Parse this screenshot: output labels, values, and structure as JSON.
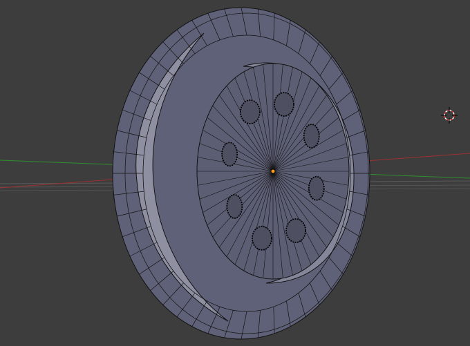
{
  "viewport": {
    "background_color": "#3d3d3d",
    "grid_line_color": "#5a5a5a",
    "axis_x_color": "#a03030",
    "axis_y_color": "#2f8f2f",
    "view_type": "3d-viewport-edit-mode"
  },
  "mesh": {
    "object": "disc-with-holes",
    "face_color": "#5f6178",
    "face_dark_color": "#52546a",
    "face_light_color": "#8e90a2",
    "edge_color": "#111111",
    "selected_vertex_color": "#ff9a1a",
    "outer_segments": 48,
    "hole_count": 8
  },
  "cursor": {
    "icon": "3d-cursor-icon",
    "color_primary": "#e03030",
    "color_secondary": "#ffffff"
  }
}
